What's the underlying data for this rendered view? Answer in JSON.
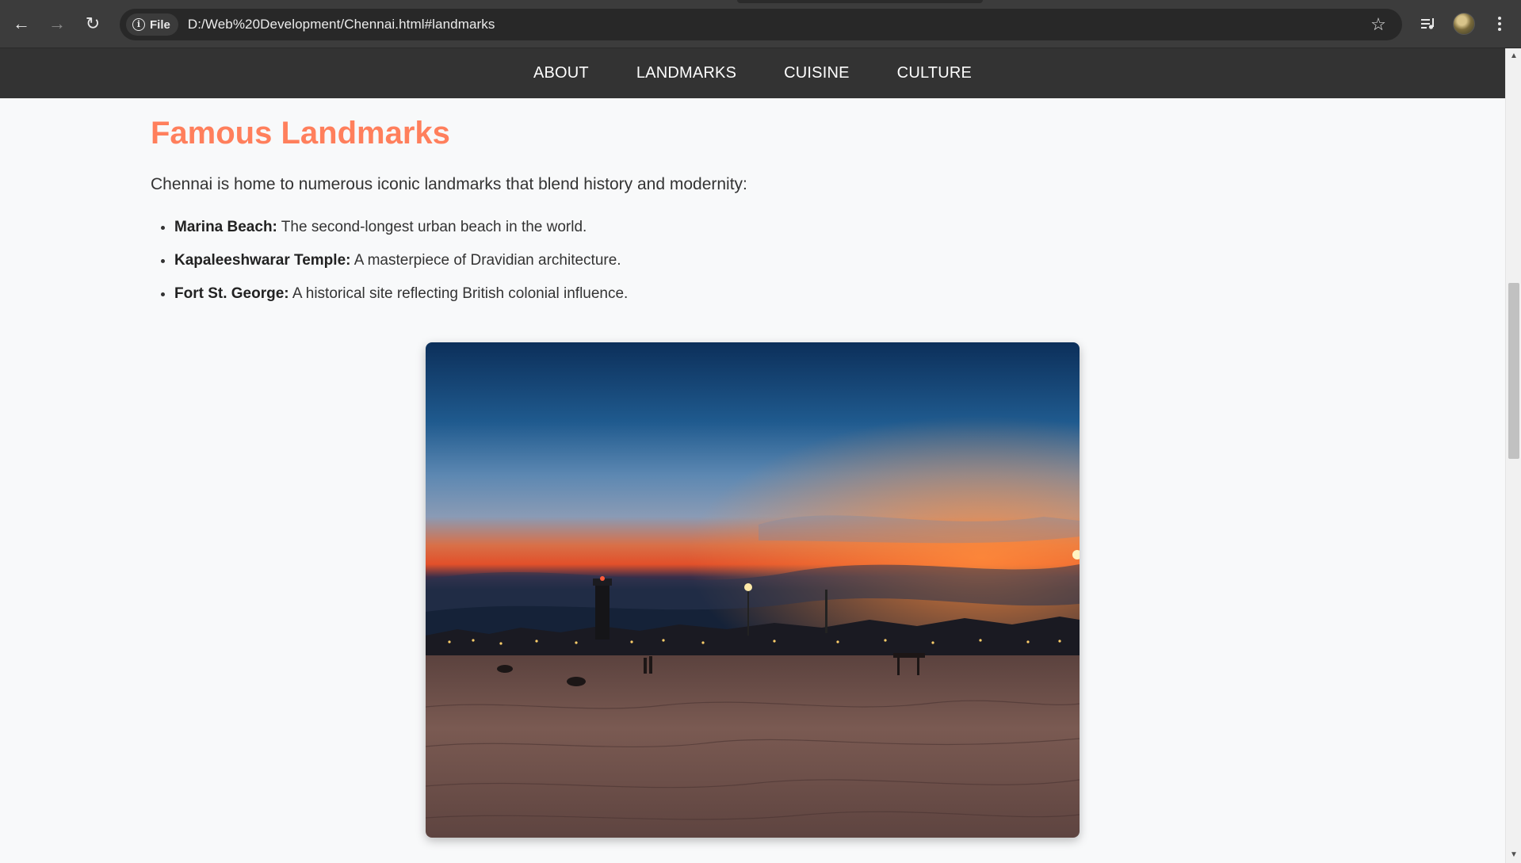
{
  "browser": {
    "back_icon": "arrow-left-icon",
    "forward_icon": "arrow-right-icon",
    "reload_icon": "reload-icon",
    "chip_label": "File",
    "url": "D:/Web%20Development/Chennai.html#landmarks",
    "bookmark_icon": "star-icon",
    "media_icon": "media-controls-icon",
    "menu_icon": "kebab-menu-icon"
  },
  "nav": {
    "items": [
      "ABOUT",
      "LANDMARKS",
      "CUISINE",
      "CULTURE"
    ]
  },
  "section": {
    "title": "Famous Landmarks",
    "intro": "Chennai is home to numerous iconic landmarks that blend history and modernity:",
    "items": [
      {
        "name": "Marina Beach:",
        "desc": " The second-longest urban beach in the world."
      },
      {
        "name": "Kapaleeshwarar Temple:",
        "desc": " A masterpiece of Dravidian architecture."
      },
      {
        "name": "Fort St. George:",
        "desc": " A historical site reflecting British colonial influence."
      }
    ]
  },
  "colors": {
    "heading": "#ff7f5c",
    "nav_bg": "#333333",
    "page_bg": "#f8f9fa"
  }
}
